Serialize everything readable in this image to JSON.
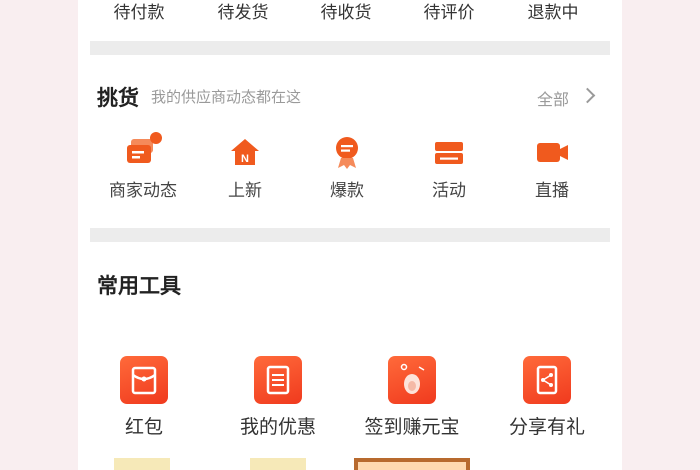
{
  "orders": {
    "items": [
      {
        "label": "待付款"
      },
      {
        "label": "待发货"
      },
      {
        "label": "待收货"
      },
      {
        "label": "待评价"
      },
      {
        "label": "退款中"
      }
    ]
  },
  "picking": {
    "title": "挑货",
    "subtitle": "我的供应商动态都在这",
    "more_label": "全部",
    "items": [
      {
        "label": "商家动态",
        "icon": "merchant-news-icon"
      },
      {
        "label": "上新",
        "icon": "new-arrival-icon"
      },
      {
        "label": "爆款",
        "icon": "hot-item-icon"
      },
      {
        "label": "活动",
        "icon": "event-ticket-icon"
      },
      {
        "label": "直播",
        "icon": "live-video-icon"
      }
    ]
  },
  "tools": {
    "title": "常用工具",
    "items": [
      {
        "label": "红包",
        "icon": "red-packet-icon"
      },
      {
        "label": "我的优惠",
        "icon": "coupon-icon"
      },
      {
        "label": "签到赚元宝",
        "icon": "check-in-ingot-icon"
      },
      {
        "label": "分享有礼",
        "icon": "share-gift-icon"
      }
    ]
  },
  "colors": {
    "accent": "#f05a1e",
    "page_bg": "#f9eef0",
    "separator": "#ececec"
  }
}
